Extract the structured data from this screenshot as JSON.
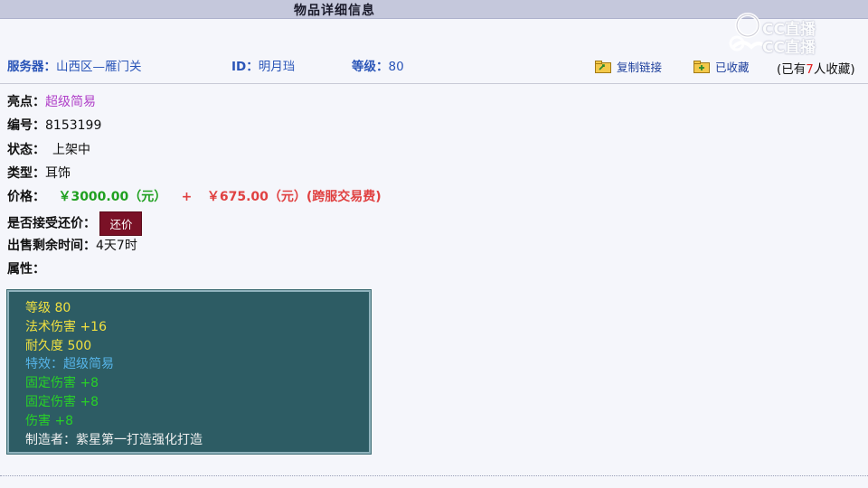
{
  "header": {
    "title": "物品详细信息"
  },
  "watermark": {
    "line1": "CC直播",
    "line2": "CC直播"
  },
  "info": {
    "server_label": "服务器：",
    "server_value": "山西区—雁门关",
    "id_label": "ID：",
    "id_value": "明月珰",
    "level_label": "等级：",
    "level_value": "80",
    "copy_link": "复制链接",
    "favorited": "已收藏",
    "fav_prefix": "(已有",
    "fav_num": "7",
    "fav_suffix": "人收藏)"
  },
  "details": {
    "highlight_label": "亮点：",
    "highlight_value": "超级简易",
    "number_label": "编号：",
    "number_value": "8153199",
    "status_label": "状态：",
    "status_value": "上架中",
    "type_label": "类型：",
    "type_value": "耳饰",
    "price_label": "价格：",
    "price_value": "￥3000.00（元）",
    "price_plus": "+",
    "fee_value": "￥675.00（元）(跨服交易费)",
    "counter_label": "是否接受还价：",
    "counter_button": "还价",
    "time_label": "出售剩余时间：",
    "time_value": "4天7时",
    "attr_label": "属性："
  },
  "attributes": [
    {
      "text": "等级 80",
      "color": "#f0e040"
    },
    {
      "text": "法术伤害 +16",
      "color": "#f0e040"
    },
    {
      "text": "耐久度 500",
      "color": "#f0e040"
    },
    {
      "text": "特效：超级简易",
      "color": "#56b4e8"
    },
    {
      "text": "固定伤害 +8",
      "color": "#28d028"
    },
    {
      "text": "固定伤害 +8",
      "color": "#28d028"
    },
    {
      "text": "伤害 +8",
      "color": "#28d028"
    },
    {
      "text": "制造者：紫星第一打造强化打造",
      "color": "#f0f0f0"
    }
  ]
}
